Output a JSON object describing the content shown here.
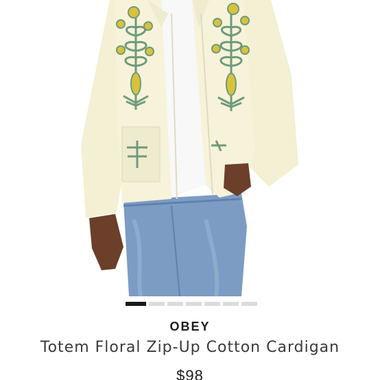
{
  "product": {
    "brand": "OBEY",
    "name": "Totem Floral Zip-Up Cotton Cardigan",
    "price": "$98",
    "image_alt": "Model wearing cream cardigan with green and yellow floral totem embroidery and light blue jeans"
  },
  "carousel": {
    "total_images": 7,
    "active_index": 0
  },
  "colors": {
    "cardigan": "#f4f1d6",
    "embroidery_green": "#6f9a7c",
    "embroidery_yellow": "#d9c23a",
    "denim": "#7c9cc4",
    "active_dot": "#1a1a1a",
    "inactive_dot": "#dcdcdc"
  }
}
